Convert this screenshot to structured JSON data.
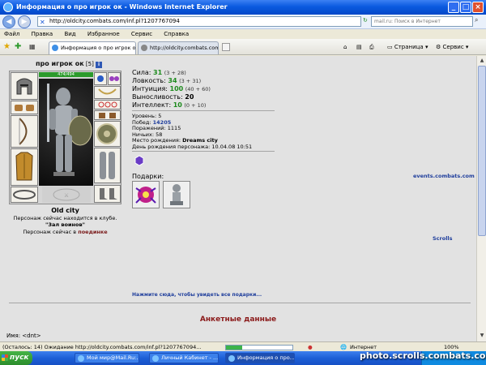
{
  "window": {
    "title": "Информация о про игрок ок - Windows Internet Explorer"
  },
  "address": {
    "url": "http://oldcity.combats.com/inf.pl?1207767094",
    "search_placeholder": "mail.ru: Поиск в Интернет"
  },
  "menu": [
    "Файл",
    "Правка",
    "Вид",
    "Избранное",
    "Сервис",
    "Справка"
  ],
  "tabs": [
    {
      "label": "Информация о про игрок ок"
    },
    {
      "label": "http://oldcity.combats.com/i..."
    }
  ],
  "toolbar": {
    "page_label": "Страница",
    "tools_label": "Сервис"
  },
  "player": {
    "name": "про игрок ок",
    "level_badge": "[5]",
    "info_icon_text": "i",
    "hp": "474/494"
  },
  "stats": [
    {
      "label": "Сила:",
      "value": "31",
      "extra": "(3 + 28)"
    },
    {
      "label": "Ловкость:",
      "value": "34",
      "extra": "(3 + 31)"
    },
    {
      "label": "Интуиция:",
      "value": "100",
      "extra": "(40 + 60)"
    },
    {
      "label": "Выносливость:",
      "value": "20",
      "extra": ""
    },
    {
      "label": "Интеллект:",
      "value": "10",
      "extra": "(0 + 10)"
    }
  ],
  "info": {
    "level": "Уровень: 5",
    "wins_label": "Побед:",
    "wins": "14205",
    "losses": "Поражений: 1115",
    "draws": "Ничьих: 58",
    "birthplace_label": "Место рождения:",
    "birthplace": "Dreams city",
    "birthday": "День рождения персонажа: 10.04.08 10:51"
  },
  "gifts_label": "Подарки:",
  "right_links": {
    "events": "events.combats.com",
    "scrolls": "Scrolls"
  },
  "location": {
    "city": "Old city",
    "line1": "Персонаж сейчас находится в клубе.",
    "club": "\"Зал воинов\"",
    "line2_prefix": "Персонаж сейчас в",
    "line2_link": "поединке"
  },
  "see_gifts_link": "Нажмите сюда, чтобы увидеть все подарки...",
  "section_title": "Анкетные данные",
  "form_name": "Имя: <dnt>",
  "statusbar": {
    "loading": "(Осталось: 14) Ожидание http://oldcity.combats.com/inf.pl?1207767094...",
    "zone": "Интернет",
    "zoom": "100%"
  },
  "taskbar": {
    "start": "пуск",
    "items": [
      {
        "label": "Мой мир@Mail.Ru:..."
      },
      {
        "label": "Личный Кабинет - ..."
      },
      {
        "label": "Информация о про..."
      }
    ]
  },
  "watermark": "photo.scrolls.combats.com"
}
